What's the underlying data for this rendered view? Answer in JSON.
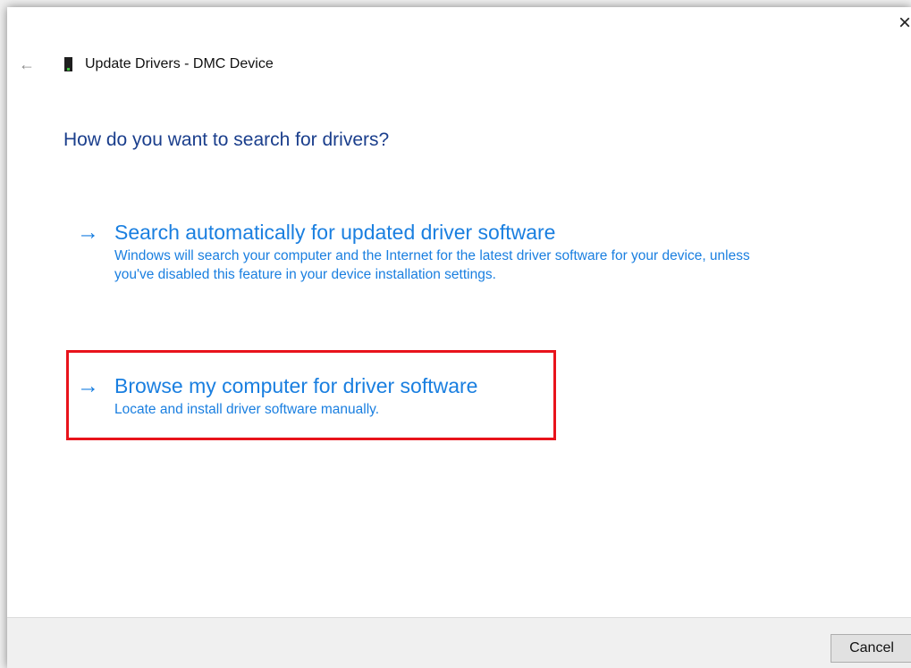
{
  "window": {
    "close_icon": "close-icon",
    "close_glyph": "×"
  },
  "header": {
    "back_icon": "back-arrow-icon",
    "back_glyph": "←",
    "device_icon": "device-icon",
    "title": "Update Drivers - DMC Device"
  },
  "main": {
    "question": "How do you want to search for drivers?",
    "options": [
      {
        "arrow_glyph": "→",
        "title": "Search automatically for updated driver software",
        "description": "Windows will search your computer and the Internet for the latest driver software for your device, unless you've disabled this feature in your device installation settings."
      },
      {
        "arrow_glyph": "→",
        "title": "Browse my computer for driver software",
        "description": "Locate and install driver software manually.",
        "highlighted": true
      }
    ]
  },
  "footer": {
    "cancel_label": "Cancel"
  },
  "colors": {
    "link_blue": "#1a7fe0",
    "heading_blue": "#1a3e8c",
    "highlight_red": "#e8131b",
    "footer_bg": "#f0f0f0"
  }
}
